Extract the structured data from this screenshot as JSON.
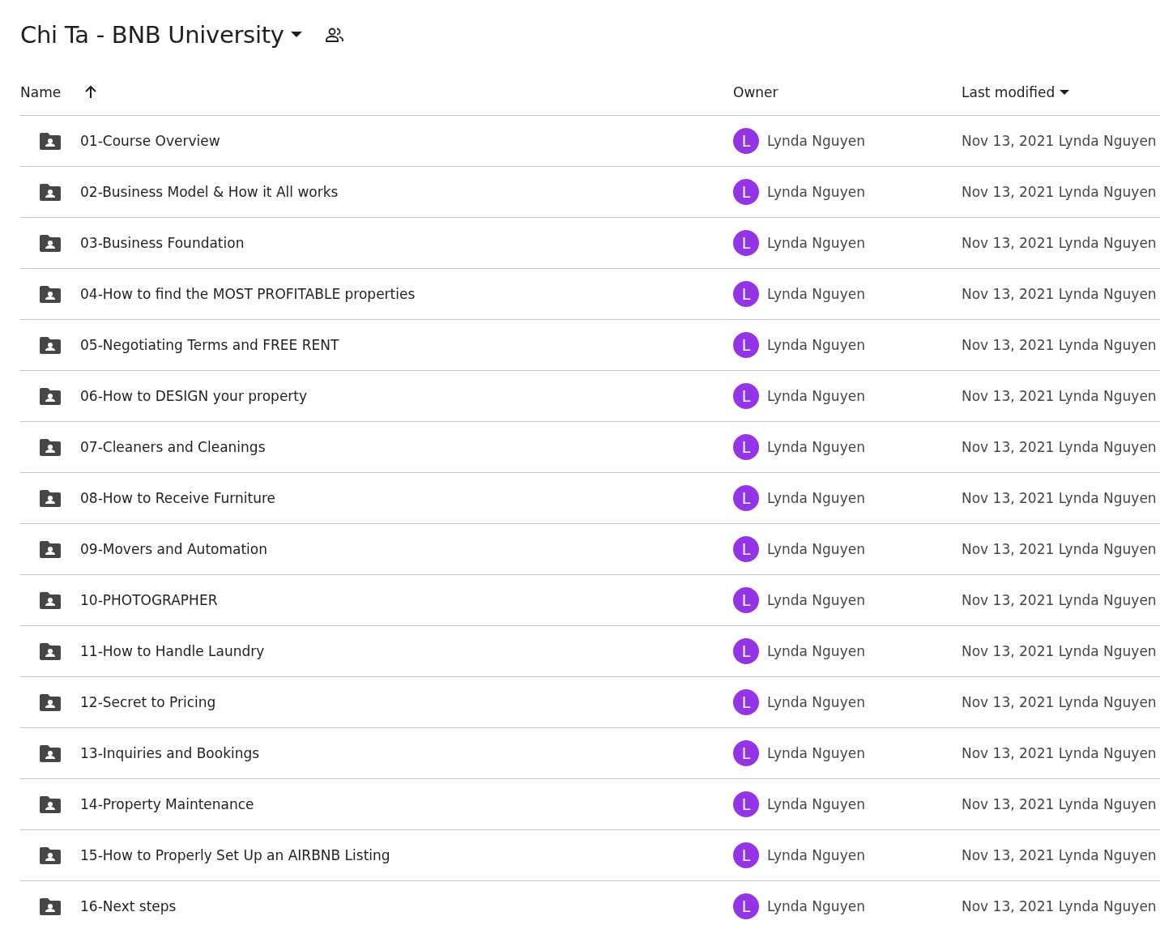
{
  "header": {
    "title": "Chi Ta - BNB University"
  },
  "table": {
    "columns": [
      {
        "label": "Name",
        "kind": "sorted"
      },
      {
        "label": "Owner",
        "kind": "plain"
      },
      {
        "label": "Last modified",
        "kind": "dropdown"
      }
    ],
    "rows": [
      {
        "name": "01-Course Overview",
        "owner_initial": "L",
        "color": "#9334e6",
        "owner": "Lynda Nguyen",
        "last_modified": "Nov 13, 2021 Lynda Nguyen"
      },
      {
        "name": "02-Business Model & How it All works",
        "owner_initial": "L",
        "color": "#9334e6",
        "owner": "Lynda Nguyen",
        "last_modified": "Nov 13, 2021 Lynda Nguyen"
      },
      {
        "name": "03-Business Foundation",
        "owner_initial": "L",
        "color": "#9334e6",
        "owner": "Lynda Nguyen",
        "last_modified": "Nov 13, 2021 Lynda Nguyen"
      },
      {
        "name": "04-How to find the MOST PROFITABLE properties",
        "owner_initial": "L",
        "color": "#9334e6",
        "owner": "Lynda Nguyen",
        "last_modified": "Nov 13, 2021 Lynda Nguyen"
      },
      {
        "name": "05-Negotiating Terms and FREE RENT",
        "owner_initial": "L",
        "color": "#9334e6",
        "owner": "Lynda Nguyen",
        "last_modified": "Nov 13, 2021 Lynda Nguyen"
      },
      {
        "name": "06-How to DESIGN your property",
        "owner_initial": "L",
        "color": "#9334e6",
        "owner": "Lynda Nguyen",
        "last_modified": "Nov 13, 2021 Lynda Nguyen"
      },
      {
        "name": "07-Cleaners and Cleanings",
        "owner_initial": "L",
        "color": "#9334e6",
        "owner": "Lynda Nguyen",
        "last_modified": "Nov 13, 2021 Lynda Nguyen"
      },
      {
        "name": "08-How to Receive Furniture",
        "owner_initial": "L",
        "color": "#9334e6",
        "owner": "Lynda Nguyen",
        "last_modified": "Nov 13, 2021 Lynda Nguyen"
      },
      {
        "name": "09-Movers and Automation",
        "owner_initial": "L",
        "color": "#9334e6",
        "owner": "Lynda Nguyen",
        "last_modified": "Nov 13, 2021 Lynda Nguyen"
      },
      {
        "name": "10-PHOTOGRAPHER",
        "owner_initial": "L",
        "color": "#9334e6",
        "owner": "Lynda Nguyen",
        "last_modified": "Nov 13, 2021 Lynda Nguyen"
      },
      {
        "name": "11-How to Handle Laundry",
        "owner_initial": "L",
        "color": "#9334e6",
        "owner": "Lynda Nguyen",
        "last_modified": "Nov 13, 2021 Lynda Nguyen"
      },
      {
        "name": "12-Secret to Pricing",
        "owner_initial": "L",
        "color": "#9334e6",
        "owner": "Lynda Nguyen",
        "last_modified": "Nov 13, 2021 Lynda Nguyen"
      },
      {
        "name": "13-Inquiries and Bookings",
        "owner_initial": "L",
        "color": "#9334e6",
        "owner": "Lynda Nguyen",
        "last_modified": "Nov 13, 2021 Lynda Nguyen"
      },
      {
        "name": "14-Property Maintenance",
        "owner_initial": "L",
        "color": "#9334e6",
        "owner": "Lynda Nguyen",
        "last_modified": "Nov 13, 2021 Lynda Nguyen"
      },
      {
        "name": "15-How to Properly Set Up an AIRBNB Listing",
        "owner_initial": "L",
        "color": "#9334e6",
        "owner": "Lynda Nguyen",
        "last_modified": "Nov 13, 2021 Lynda Nguyen"
      },
      {
        "name": "16-Next steps",
        "owner_initial": "L",
        "color": "#9334e6",
        "owner": "Lynda Nguyen",
        "last_modified": "Nov 13, 2021 Lynda Nguyen"
      }
    ]
  }
}
